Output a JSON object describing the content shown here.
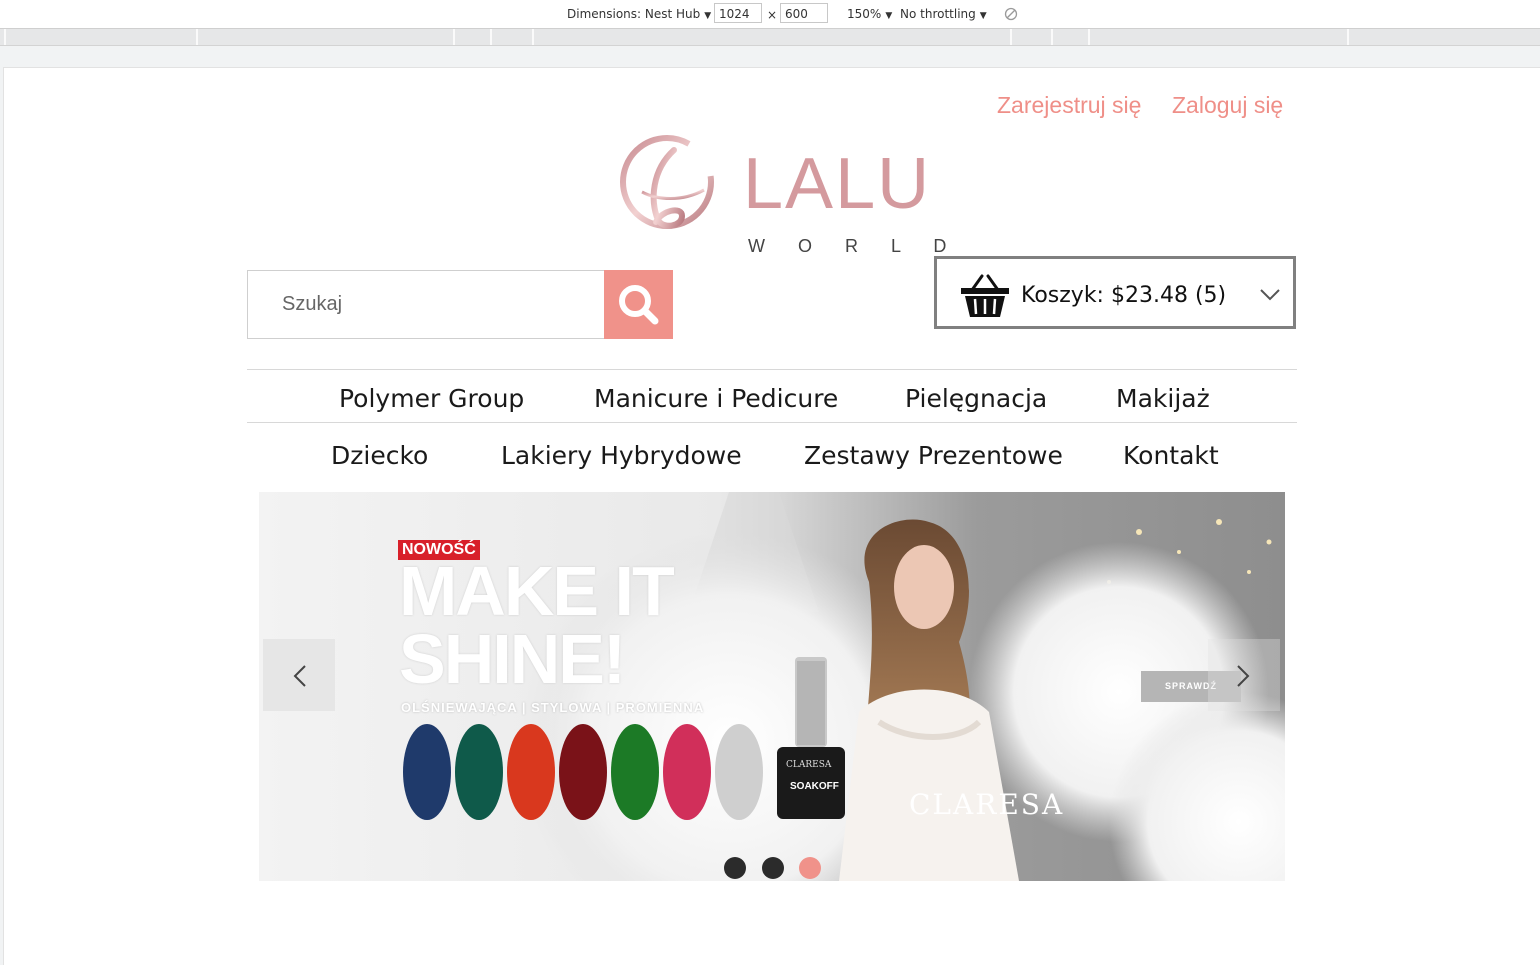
{
  "devtools": {
    "dimensions_label": "Dimensions: Nest Hub",
    "width_value": "1024",
    "times": "×",
    "height_value": "600",
    "zoom": "150%",
    "throttling": "No throttling"
  },
  "header": {
    "register": "Zarejestruj się",
    "login": "Zaloguj się",
    "logo_main": "LALU",
    "logo_sub": "W O R L D"
  },
  "search": {
    "placeholder": "Szukaj"
  },
  "cart": {
    "label": "Koszyk: $23.48 (5)"
  },
  "nav": {
    "row1": [
      "Polymer Group",
      "Manicure i Pedicure",
      "Pielęgnacja",
      "Makijaż"
    ],
    "row2": [
      "Dziecko",
      "Lakiery Hybrydowe",
      "Zestawy Prezentowe",
      "Kontakt"
    ]
  },
  "banner": {
    "badge": "NOWOŚĆ",
    "headline_1": "MAKE IT",
    "headline_2": "SHINE!",
    "tagline": "OLŚNIEWAJĄCA | STYLOWA | PROMIENNA",
    "bottle_brand": "CLARESA",
    "bottle_line": "SOAKOFF",
    "brand": "CLARESA",
    "cta": "SPRAWDŹ",
    "active_slide": 3,
    "slide_count": 3
  },
  "colors": {
    "accent": "#f0928a",
    "link": "#ef8f88",
    "badge": "#d8202a"
  }
}
